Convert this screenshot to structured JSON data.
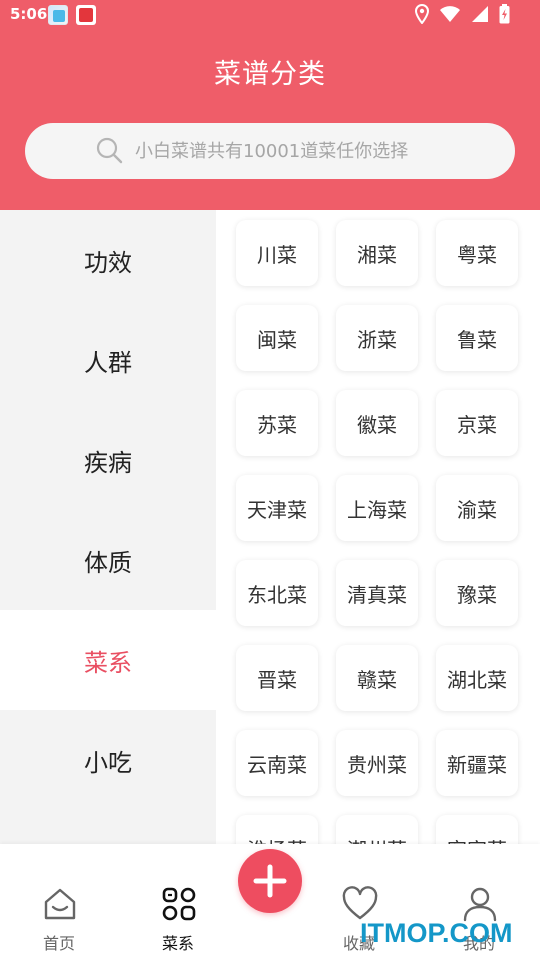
{
  "status_bar": {
    "time": "5:06"
  },
  "header": {
    "title": "菜谱分类",
    "search": {
      "placeholder": "小白菜谱共有10001道菜任你选择"
    }
  },
  "sidebar": {
    "items": [
      "功效",
      "人群",
      "疾病",
      "体质",
      "菜系",
      "小吃"
    ],
    "active_index": 4
  },
  "categories": [
    "川菜",
    "湘菜",
    "粤菜",
    "闽菜",
    "浙菜",
    "鲁菜",
    "苏菜",
    "徽菜",
    "京菜",
    "天津菜",
    "上海菜",
    "渝菜",
    "东北菜",
    "清真菜",
    "豫菜",
    "晋菜",
    "赣菜",
    "湖北菜",
    "云南菜",
    "贵州菜",
    "新疆菜",
    "淮扬菜",
    "潮州菜",
    "客家菜"
  ],
  "bottom_nav": {
    "home": "首页",
    "cuisine": "菜系",
    "favorites": "收藏",
    "me": "我的"
  },
  "watermark": "ITMOP.COM",
  "colors": {
    "header_bg": "#ef5d69",
    "accent": "#e94f62",
    "add_button": "#ee4d60",
    "sidebar_bg": "#f3f3f3"
  }
}
